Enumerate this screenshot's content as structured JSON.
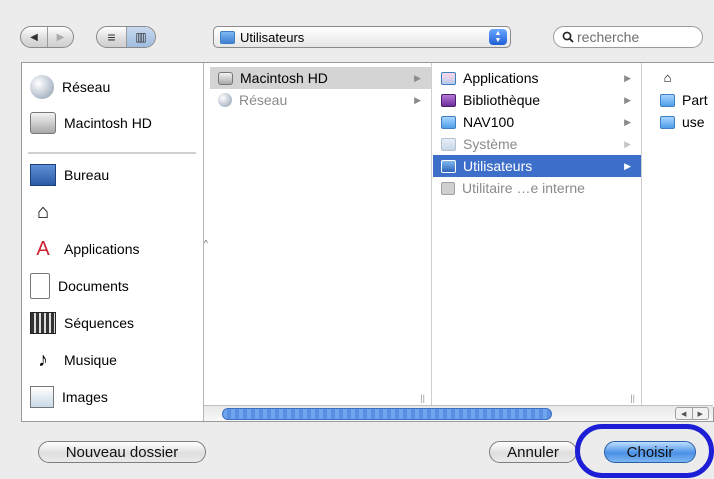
{
  "toolbar": {
    "back_icon": "◀",
    "forward_icon": "▶",
    "list_view_icon": "≡",
    "column_view_icon": "▥",
    "location": "Utilisateurs",
    "search_placeholder": "recherche",
    "search_icon": "magnifier"
  },
  "sidebar": {
    "items": [
      {
        "label": "Réseau",
        "icon": "network-globe-icon"
      },
      {
        "label": "Macintosh HD",
        "icon": "hard-disk-icon"
      },
      {
        "label": "Bureau",
        "icon": "desktop-icon"
      },
      {
        "label": "",
        "icon": "home-icon"
      },
      {
        "label": "Applications",
        "icon": "applications-icon"
      },
      {
        "label": "Documents",
        "icon": "document-icon"
      },
      {
        "label": "Séquences",
        "icon": "film-icon"
      },
      {
        "label": "Musique",
        "icon": "music-icon"
      },
      {
        "label": "Images",
        "icon": "pictures-icon"
      }
    ]
  },
  "columns": [
    {
      "rows": [
        {
          "label": "Macintosh HD",
          "state": "highlight",
          "has_children": true
        },
        {
          "label": "Réseau",
          "state": "dim",
          "has_children": true
        }
      ]
    },
    {
      "rows": [
        {
          "label": "Applications",
          "state": "normal",
          "has_children": true
        },
        {
          "label": "Bibliothèque",
          "state": "normal",
          "has_children": true
        },
        {
          "label": "NAV100",
          "state": "normal",
          "has_children": true
        },
        {
          "label": "Système",
          "state": "dim",
          "has_children": true
        },
        {
          "label": "Utilisateurs",
          "state": "selected",
          "has_children": true
        },
        {
          "label": "Utilitaire …e interne",
          "state": "dim",
          "has_children": false
        }
      ]
    },
    {
      "rows": [
        {
          "label": "",
          "icon": "home-icon"
        },
        {
          "label": "Part",
          "icon": "folder-icon"
        },
        {
          "label": "use",
          "icon": "folder-icon"
        }
      ]
    }
  ],
  "buttons": {
    "new_folder": "Nouveau dossier",
    "cancel": "Annuler",
    "choose": "Choisir"
  },
  "colors": {
    "selection": "#3d6ec9",
    "default_button": "#4a90e6",
    "annotation_ring": "#1c1fd6"
  }
}
